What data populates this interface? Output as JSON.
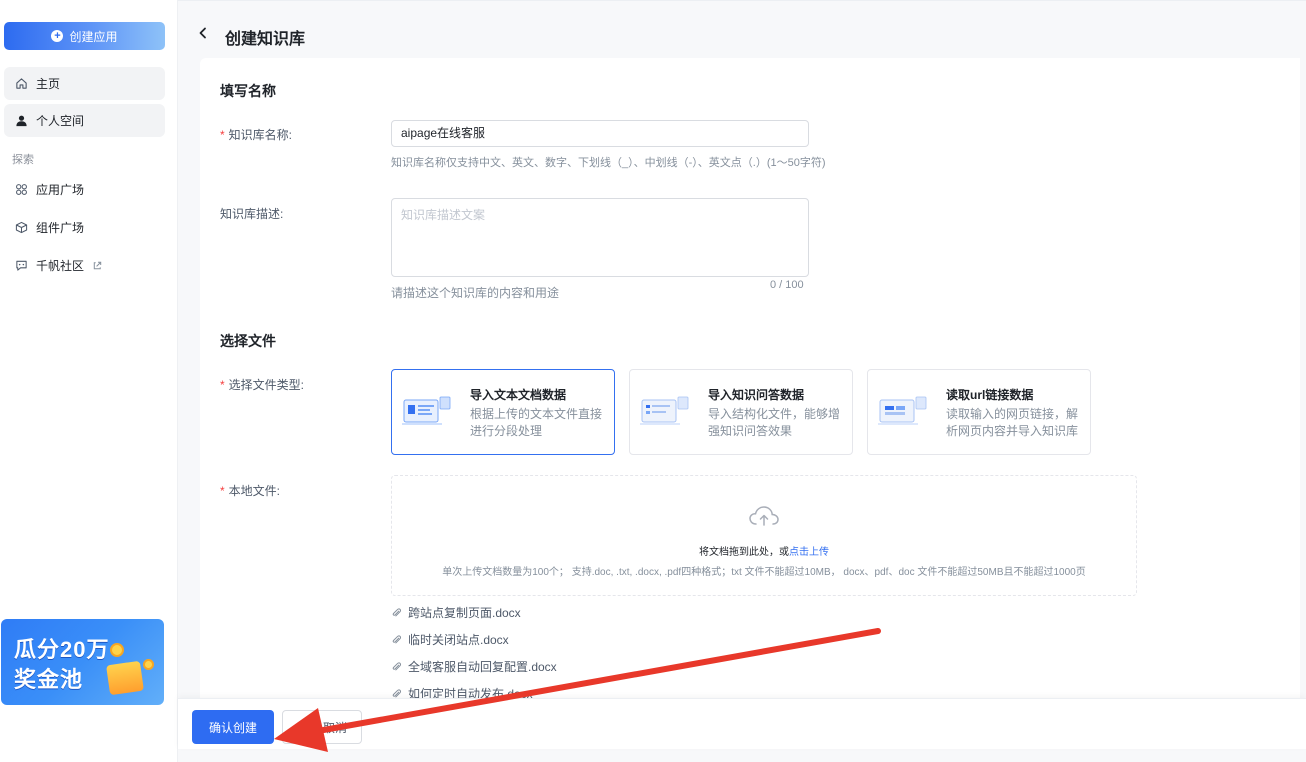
{
  "sidebar": {
    "create_button": "创建应用",
    "nav": {
      "home": "主页",
      "personal_space": "个人空间",
      "explore_label": "探索",
      "app_plaza": "应用广场",
      "component_plaza": "组件广场",
      "community": "千帆社区"
    },
    "promo": {
      "line1": "瓜分20万",
      "line2": "奖金池"
    }
  },
  "header": {
    "title": "创建知识库"
  },
  "form": {
    "name_section": "填写名称",
    "name_label": "知识库名称:",
    "name_value": "aipage在线客服",
    "name_hint": "知识库名称仅支持中文、英文、数字、下划线（_）、中划线（-）、英文点（.）(1～50字符)",
    "desc_label": "知识库描述:",
    "desc_placeholder": "知识库描述文案",
    "desc_hint": "请描述这个知识库的内容和用途",
    "desc_counter": "0 / 100",
    "file_section": "选择文件",
    "file_type_label": "选择文件类型:",
    "file_types": [
      {
        "title": "导入文本文档数据",
        "desc": "根据上传的文本文件直接进行分段处理"
      },
      {
        "title": "导入知识问答数据",
        "desc": "导入结构化文件，能够增强知识问答效果"
      },
      {
        "title": "读取url链接数据",
        "desc": "读取输入的网页链接，解析网页内容并导入知识库"
      }
    ],
    "local_file_label": "本地文件:",
    "upload": {
      "main_text": "将文档拖到此处，或",
      "link_text": "点击上传",
      "sub_text": "单次上传文档数量为100个； 支持.doc, .txt, .docx, .pdf四种格式；txt 文件不能超过10MB， docx、pdf、doc 文件不能超过50MB且不能超过1000页"
    },
    "files": [
      "跨站点复制页面.docx",
      "临时关闭站点.docx",
      "全域客服自动回复配置.docx",
      "如何定时自动发布.docx"
    ]
  },
  "footer": {
    "confirm": "确认创建",
    "cancel": "取消"
  },
  "colors": {
    "primary": "#2e6cf2",
    "annotation_arrow": "#e8382a",
    "required": "#f53f3f"
  }
}
